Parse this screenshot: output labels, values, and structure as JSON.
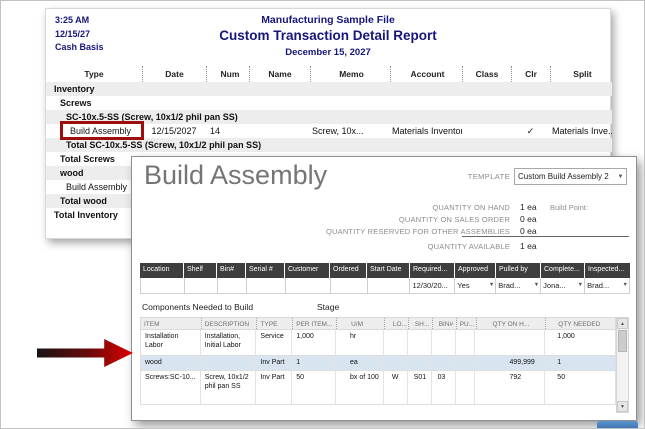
{
  "colors": {
    "navy": "#16167c",
    "highlight_red": "#9d0d0d",
    "row_highlight_blue": "#d9e4f1",
    "grid_header_dark": "#3e3e3e",
    "accent_blue": "#3877b8"
  },
  "icons": {
    "chevron_down": "▼",
    "scroll_up": "▲",
    "scroll_down": "▼"
  },
  "report": {
    "time": "3:25 AM",
    "date": "12/15/27",
    "basis": "Cash Basis",
    "company": "Manufacturing Sample File",
    "title": "Custom Transaction Detail Report",
    "date_range": "December 15, 2027",
    "columns": [
      "Type",
      "Date",
      "Num",
      "Name",
      "Memo",
      "Account",
      "Class",
      "Clr",
      "Split"
    ],
    "rows": {
      "inventory": "Inventory",
      "screws": "Screws",
      "sc_item": "SC-10x.5-SS (Screw, 10x1/2 phil pan SS)",
      "total_sc": "Total SC-10x.5-SS (Screw, 10x1/2 phil pan SS)",
      "total_screws": "Total Screws",
      "wood": "wood",
      "wood_detail": "Build Assembly",
      "total_wood": "Total wood",
      "total_inventory": "Total Inventory"
    },
    "detail": {
      "type": "Build Assembly",
      "date": "12/15/2027",
      "num": "14",
      "memo": "Screw, 10x...",
      "account": "Materials Inventory",
      "clr": "✓",
      "split": "Materials Inve..."
    }
  },
  "form": {
    "title": "Build Assembly",
    "template": {
      "label": "TEMPLATE",
      "value": "Custom Build Assembly 2"
    },
    "quantities": [
      {
        "label": "QUANTITY ON HAND",
        "value": "1 ea",
        "extra": "Build Point:"
      },
      {
        "label": "QUANTITY ON SALES ORDER",
        "value": "0 ea",
        "extra": ""
      },
      {
        "label": "QUANTITY RESERVED FOR OTHER ASSEMBLIES",
        "value": "0 ea",
        "extra": ""
      },
      {
        "label": "QUANTITY AVAILABLE",
        "value": "1 ea",
        "extra": ""
      }
    ],
    "tracking": {
      "columns": [
        "Location",
        "Shelf",
        "Bin#",
        "Serial #",
        "Customer",
        "Ordered",
        "Start Date",
        "Required...",
        "Approved",
        "Pulled by",
        "Complete...",
        "Inspected..."
      ],
      "row": {
        "required": "12/30/20...",
        "approved": "Yes",
        "pulled_by": "Brad...",
        "complete": "Jona...",
        "inspected": "Brad..."
      }
    },
    "components": {
      "label": "Components Needed to Build",
      "stage": "Stage",
      "columns": [
        "ITEM",
        "DESCRIPTION",
        "TYPE",
        "PER ITEM...",
        "U/M",
        "LO...",
        "SH...",
        "BIN#",
        "PU...",
        "QTY ON H...",
        "QTY NEEDED"
      ],
      "rows": [
        [
          "Installation Labor",
          "Installation, Initial Labor",
          "Service",
          "1,000",
          "hr",
          "",
          "",
          "",
          "",
          "",
          "1,000"
        ],
        [
          "wood",
          "",
          "Inv Part",
          "1",
          "ea",
          "",
          "",
          "",
          "",
          "499,999",
          "1"
        ],
        [
          "Screws:SC-10...",
          "Screw, 10x1/2 phil pan SS",
          "Inv Part",
          "50",
          "bx of 100",
          "W",
          "S01",
          "03",
          "",
          "792",
          "50"
        ]
      ]
    }
  }
}
